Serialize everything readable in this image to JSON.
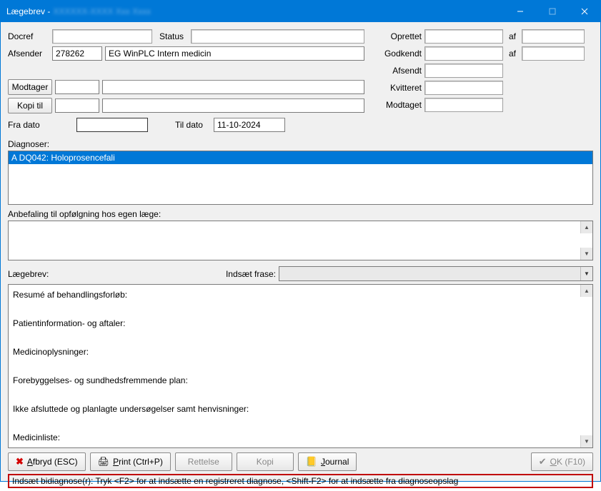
{
  "window": {
    "title_prefix": "Lægebrev - ",
    "title_blur": "XXXXXX-XXXX Xxx Xxxx"
  },
  "header": {
    "docref_label": "Docref",
    "docref_value": "",
    "status_label_mid": "Status",
    "status_value": "",
    "oprettet_label": "Oprettet",
    "oprettet_value": "",
    "af_label": "af",
    "af1_value": "",
    "afsender_label": "Afsender",
    "afsender_code": "278262",
    "afsender_name": "EG WinPLC Intern medicin",
    "godkendt_label": "Godkendt",
    "godkendt_value": "",
    "af2_value": "",
    "afsendt_label": "Afsendt",
    "afsendt_value": "",
    "modtager_btn": "Modtager",
    "modtager_code": "",
    "modtager_name": "",
    "kvitteret_label": "Kvitteret",
    "kvitteret_value": "",
    "kopi_btn": "Kopi til",
    "kopi_code": "",
    "kopi_name": "",
    "modtaget_label": "Modtaget",
    "modtaget_value": "",
    "fra_dato_label": "Fra dato",
    "fra_dato_value": "",
    "til_dato_label": "Til dato",
    "til_dato_value": "11-10-2024"
  },
  "diagnoser": {
    "label": "Diagnoser:",
    "items": [
      "A DQ042: Holoprosencefali"
    ]
  },
  "anbefaling": {
    "label": "Anbefaling til opfølgning hos egen læge:",
    "value": ""
  },
  "laegebrev": {
    "label": "Lægebrev:",
    "phrase_label": "Indsæt frase:",
    "phrase_value": "",
    "body_lines": [
      "Resumé af behandlingsforløb:",
      "",
      "Patientinformation- og aftaler:",
      "",
      "Medicinoplysninger:",
      "",
      "Forebyggelses- og sundhedsfremmende plan:",
      "",
      "Ikke afsluttede og planlagte undersøgelser samt henvisninger:",
      "",
      "Medicinliste:"
    ]
  },
  "buttons": {
    "afbryd": "Afbryd (ESC)",
    "print": "Print (Ctrl+P)",
    "rettelse": "Rettelse",
    "kopi": "Kopi",
    "journal": "Journal",
    "ok": "OK (F10)"
  },
  "status_hint": "Indsæt bidiagnose(r): Tryk <F2> for at indsætte en registreret diagnose, <Shift-F2> for at indsætte fra diagnoseopslag"
}
